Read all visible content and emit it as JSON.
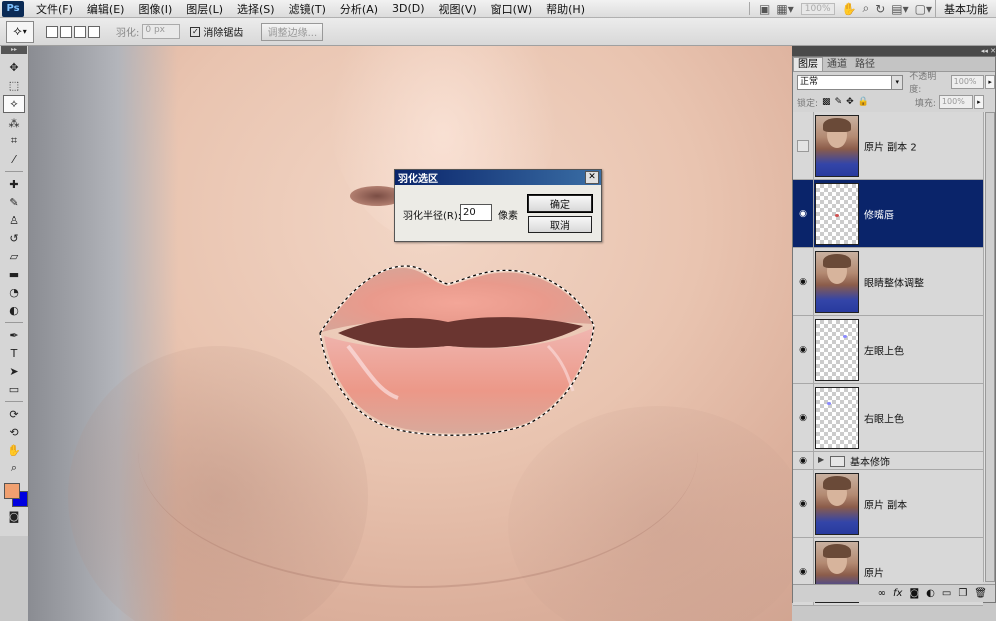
{
  "app": {
    "logo": "Ps"
  },
  "menubar": {
    "items": [
      "文件(F)",
      "编辑(E)",
      "图像(I)",
      "图层(L)",
      "选择(S)",
      "滤镜(T)",
      "分析(A)",
      "3D(D)",
      "视图(V)",
      "窗口(W)",
      "帮助(H)"
    ],
    "zoom": "100%",
    "workspace": "基本功能"
  },
  "options": {
    "feather_label": "羽化:",
    "feather_value": "0 px",
    "antialias_label": "消除锯齿",
    "refine_edge": "调整边缘..."
  },
  "dialog": {
    "title": "羽化选区",
    "radius_label": "羽化半径(R):",
    "radius_value": "20",
    "unit": "像素",
    "ok": "确定",
    "cancel": "取消"
  },
  "layers_panel": {
    "tabs": [
      "图层",
      "通道",
      "路径"
    ],
    "blend_mode": "正常",
    "opacity_label": "不透明度:",
    "opacity_value": "100%",
    "lock_label": "锁定:",
    "fill_label": "填充:",
    "fill_value": "100%",
    "layers": [
      {
        "name": "原片 副本 2",
        "visible": false,
        "thumb": "photo",
        "selected": false
      },
      {
        "name": "修嘴唇",
        "visible": true,
        "thumb": "checker",
        "selected": true
      },
      {
        "name": "眼睛整体调整",
        "visible": true,
        "thumb": "photo",
        "selected": false
      },
      {
        "name": "左眼上色",
        "visible": true,
        "thumb": "checker",
        "selected": false
      },
      {
        "name": "右眼上色",
        "visible": true,
        "thumb": "checker",
        "selected": false
      },
      {
        "name": "基本修饰",
        "visible": true,
        "thumb": "folder",
        "selected": false
      },
      {
        "name": "原片 副本",
        "visible": true,
        "thumb": "photo",
        "selected": false
      },
      {
        "name": "原片",
        "visible": true,
        "thumb": "photo",
        "selected": false
      }
    ],
    "bottom_icons": [
      "link-icon",
      "fx-icon",
      "mask-icon",
      "adjustment-icon",
      "group-icon",
      "new-layer-icon",
      "trash-icon"
    ]
  },
  "colors": {
    "foreground": "#f0a070",
    "background": "#0000e0",
    "selection_bg": "#0a246a"
  }
}
